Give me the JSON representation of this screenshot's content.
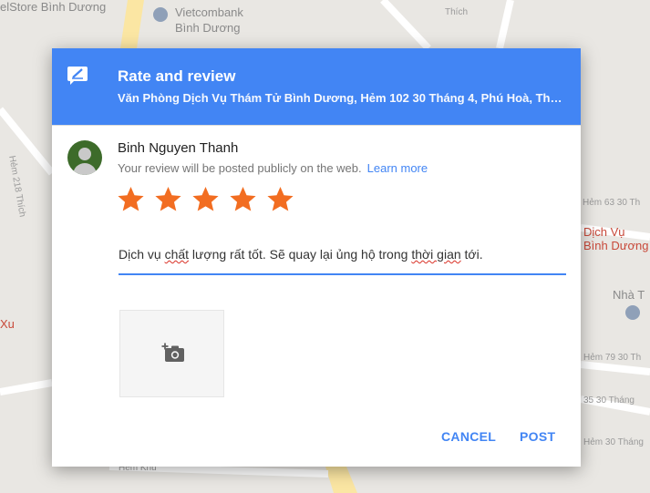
{
  "map": {
    "labels": [
      "elStore Bình Dương",
      "Vietcombank",
      "Bình Dương",
      "Thích",
      "Hẻm 218 Thích",
      "Hẻm 63 30 Th",
      "Dịch Vụ",
      "Bình Dương",
      "Nhà T",
      "Hẻm 79 30 Th",
      "35 30 Tháng",
      "Hẻm 30 Tháng",
      "Hẻm Khu",
      "Xu"
    ]
  },
  "dialog": {
    "title": "Rate and review",
    "subtitle": "Văn Phòng Dịch Vụ Thám Tử Bình Dương, Hẻm 102 30 Tháng 4, Phú Hoà, Thủ Dầu Một, Bình Dương",
    "user_name": "Binh Nguyen Thanh",
    "notice": "Your review will be posted publicly on the web.",
    "learn_more": "Learn more",
    "rating": 5,
    "rating_max": 5,
    "review": {
      "part1": "Dịch vụ ",
      "word1": "chất",
      "part2": " lượng rất tốt. Sẽ quay lại ủng hộ trong ",
      "word2": "thời gian",
      "part3": " tới."
    },
    "cancel_label": "CANCEL",
    "post_label": "POST",
    "icons": {
      "header": "edit-review-icon",
      "avatar": "user-avatar",
      "photo": "add-photo-icon",
      "star": "star-icon"
    }
  },
  "colors": {
    "header": "#4285f4",
    "star": "#f26d21",
    "link": "#4285f4"
  }
}
